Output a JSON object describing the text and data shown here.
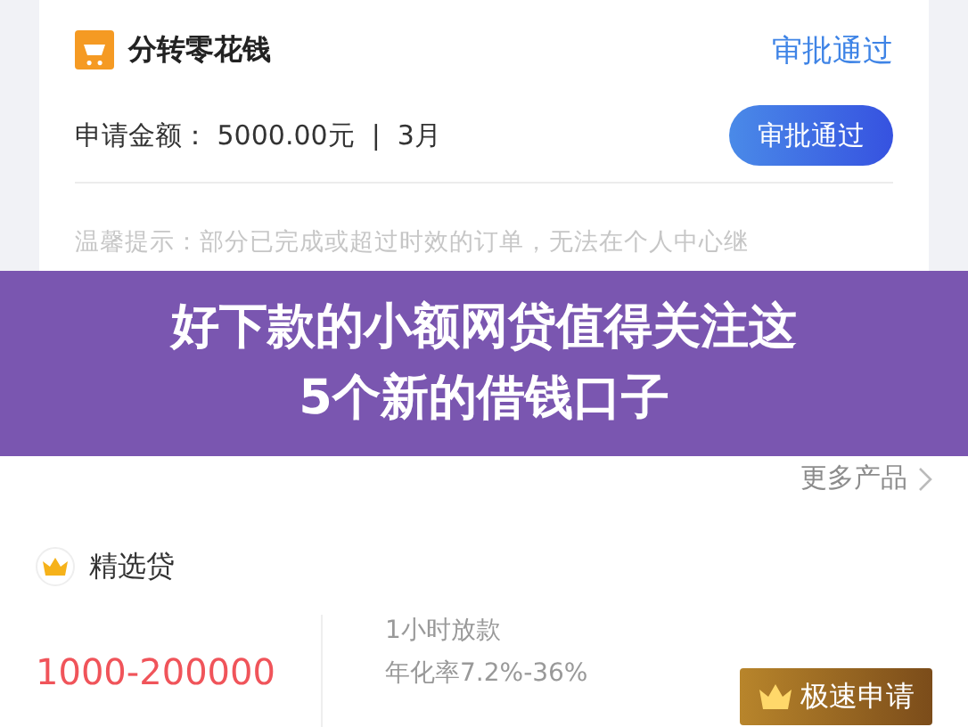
{
  "order": {
    "app_name": "分转零花钱",
    "status": "审批通过",
    "amount_label": "申请金额：",
    "amount": "5000.00元",
    "separator": "|",
    "term": "3月",
    "action": "审批通过",
    "notice": "温馨提示：部分已完成或超过时效的订单，无法在个人中心继"
  },
  "banner": {
    "lines": [
      "好下款的小额网贷值得关注这",
      "5个新的借钱口子"
    ]
  },
  "more_link": "更多产品",
  "product": {
    "name": "精选贷",
    "amount_range": "1000-200000",
    "features": [
      "1小时放款",
      "年化率7.2%-36%"
    ],
    "apply": "极速申请"
  }
}
